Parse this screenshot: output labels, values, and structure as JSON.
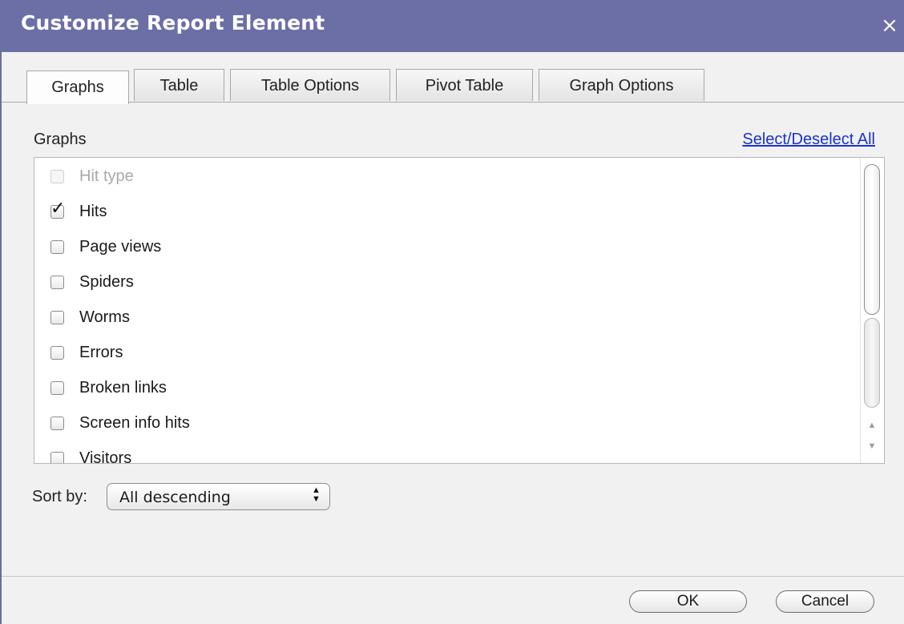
{
  "dialog": {
    "title": "Customize Report Element",
    "close_glyph": "×"
  },
  "tabs": [
    {
      "label": "Graphs",
      "active": true
    },
    {
      "label": "Table",
      "active": false
    },
    {
      "label": "Table Options",
      "active": false
    },
    {
      "label": "Pivot Table",
      "active": false
    },
    {
      "label": "Graph Options",
      "active": false
    }
  ],
  "graphs": {
    "section_label": "Graphs",
    "select_all_label": "Select/Deselect All",
    "items": [
      {
        "label": "Hit type",
        "checked": false,
        "disabled": true
      },
      {
        "label": "Hits",
        "checked": true,
        "disabled": false
      },
      {
        "label": "Page views",
        "checked": false,
        "disabled": false
      },
      {
        "label": "Spiders",
        "checked": false,
        "disabled": false
      },
      {
        "label": "Worms",
        "checked": false,
        "disabled": false
      },
      {
        "label": "Errors",
        "checked": false,
        "disabled": false
      },
      {
        "label": "Broken links",
        "checked": false,
        "disabled": false
      },
      {
        "label": "Screen info hits",
        "checked": false,
        "disabled": false
      },
      {
        "label": "Visitors",
        "checked": false,
        "disabled": false
      }
    ],
    "scroll_up_glyph": "▲",
    "scroll_down_glyph": "▼"
  },
  "sort": {
    "label": "Sort by:",
    "value": "All descending"
  },
  "footer": {
    "ok_label": "OK",
    "cancel_label": "Cancel"
  },
  "colors": {
    "titlebar": "#6b6fa6",
    "link": "#1a33cc",
    "panel": "#f1f1f1"
  }
}
